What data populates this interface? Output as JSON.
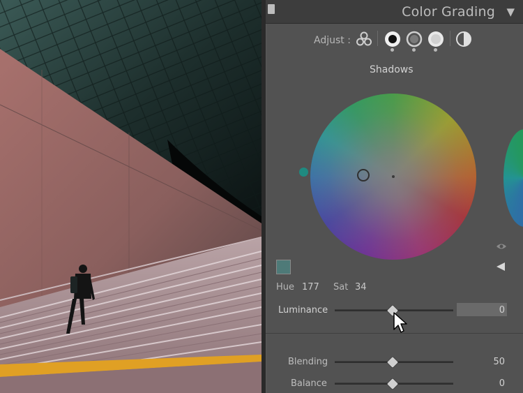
{
  "panel": {
    "title": "Color Grading",
    "adjust_label": "Adjust :",
    "wheel_title": "Shadows",
    "mode_icons": [
      "three-wheels-icon",
      "shadows-wheel-icon",
      "midtones-wheel-icon",
      "highlights-wheel-icon",
      "global-icon"
    ]
  },
  "shadows": {
    "hue_label": "Hue",
    "hue_value": "177",
    "sat_label": "Sat",
    "sat_value": "34",
    "swatch_color": "#4e7a78"
  },
  "sliders": [
    {
      "label": "Luminance",
      "value": "0",
      "position": 0.5
    },
    {
      "label": "Blending",
      "value": "50",
      "position": 0.5
    },
    {
      "label": "Balance",
      "value": "0",
      "position": 0.5
    }
  ],
  "colors": {
    "panel_bg": "#525252",
    "header_bg": "#3d3d3d",
    "accent_teal": "#1f8a80"
  }
}
